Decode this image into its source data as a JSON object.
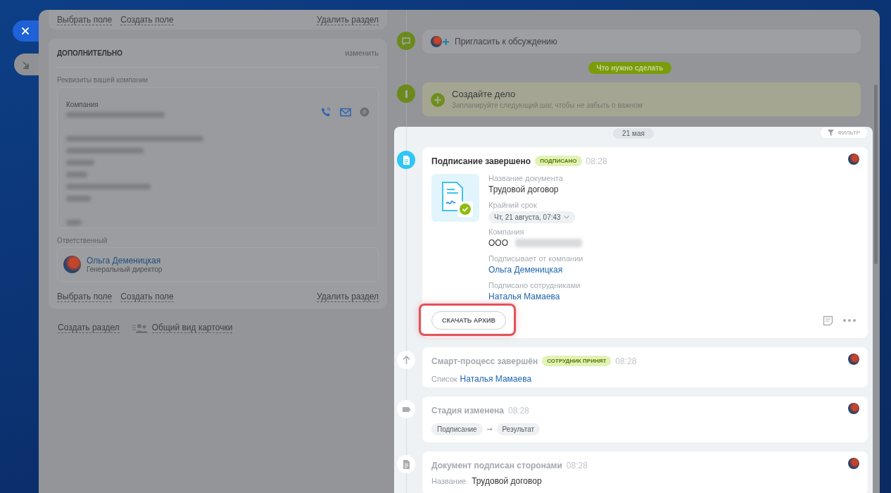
{
  "left": {
    "top_section": {
      "links": [
        "Выбрать поле",
        "Создать поле"
      ],
      "delete_link": "Удалить раздел"
    },
    "section": {
      "title": "ДОПОЛНИТЕЛЬНО",
      "edit_link": "изменить",
      "requisites_label": "Реквизиты вашей компании",
      "company_label": "Компания",
      "responsible_label": "Ответственный",
      "responsible": {
        "name": "Ольга Деменицкая",
        "position": "Генеральный директор"
      },
      "links": [
        "Выбрать поле",
        "Создать поле"
      ],
      "delete_link": "Удалить раздел"
    },
    "footer_links": {
      "create_section": "Создать раздел",
      "card_view": "Общий вид карточки"
    }
  },
  "timeline": {
    "invite": "Пригласить к обсуждению",
    "todo_divider": "Что нужно сделать",
    "create_task": {
      "title": "Создайте дело",
      "hint": "Запланируйте следующий шаг, чтобы не забыть о важном"
    },
    "date": "21 мая",
    "filter": "ФИЛЬТР",
    "events": [
      {
        "kind": "document",
        "active": true,
        "title": "Подписание завершено",
        "badge": "ПОДПИСАНО",
        "time": "08:28",
        "fields": [
          {
            "kind": "text",
            "label": "Название документа",
            "value": "Трудовой договор"
          },
          {
            "kind": "chip",
            "label": "Крайний срок",
            "value": "Чт, 21 августа, 07:43"
          },
          {
            "kind": "redacted",
            "label": "Компания",
            "value": "ООО"
          },
          {
            "kind": "link",
            "label": "Подписывает от компании",
            "value": "Ольга Деменицкая"
          },
          {
            "kind": "link",
            "label": "Подписано сотрудниками",
            "value": "Наталья Мамаева"
          }
        ],
        "button": "СКАЧАТЬ АРХИВ",
        "highlighted": true
      },
      {
        "kind": "smart",
        "active": false,
        "title": "Смарт-процесс завершён",
        "badge": "СОТРУДНИК ПРИНЯТ",
        "time": "08:28",
        "line": {
          "kind": "link",
          "label": "Список",
          "value": "Наталья Мамаева"
        }
      },
      {
        "kind": "stage",
        "active": false,
        "title": "Стадия изменена",
        "time": "08:28",
        "stages": [
          "Подписание",
          "Результат"
        ]
      },
      {
        "kind": "signed",
        "active": false,
        "title": "Документ подписан сторонами",
        "time": "08:28",
        "line": {
          "kind": "text",
          "label": "Название",
          "value": "Трудовой договор"
        }
      }
    ]
  }
}
